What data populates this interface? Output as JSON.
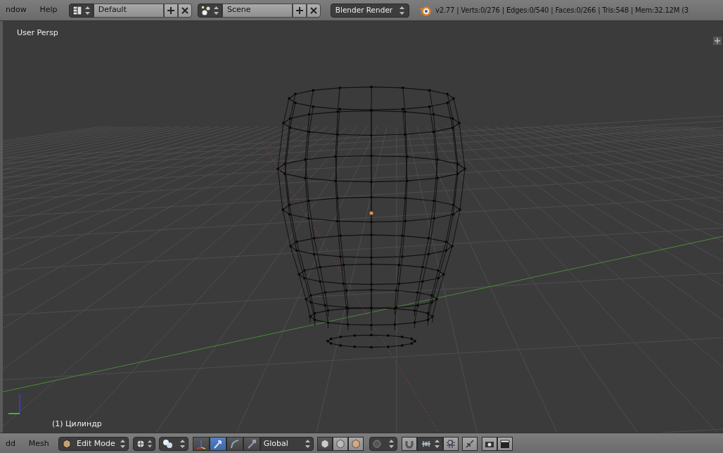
{
  "top_bar": {
    "menus": [
      "ndow",
      "Help"
    ],
    "screen_layout": {
      "value": "Default"
    },
    "scene": {
      "value": "Scene"
    },
    "render_engine": {
      "value": "Blender Render"
    },
    "stats": "v2.77 | Verts:0/276 | Edges:0/540 | Faces:0/266 | Tris:548 | Mem:32.12M (3"
  },
  "viewport": {
    "view_label": "User Persp",
    "object_label": "(1) Цилиндр"
  },
  "bottom_bar": {
    "menus": [
      "dd",
      "Mesh"
    ],
    "mode": {
      "value": "Edit Mode"
    },
    "manipulators": [
      {
        "kind": "toggle",
        "selected": false
      },
      {
        "kind": "move",
        "selected": true
      },
      {
        "kind": "rotate",
        "selected": false
      },
      {
        "kind": "scale",
        "selected": false
      }
    ],
    "orientation": {
      "value": "Global"
    },
    "select_modes": [
      {
        "kind": "vertex",
        "selected": true
      },
      {
        "kind": "edge",
        "selected": false
      },
      {
        "kind": "face",
        "selected": false
      }
    ]
  }
}
